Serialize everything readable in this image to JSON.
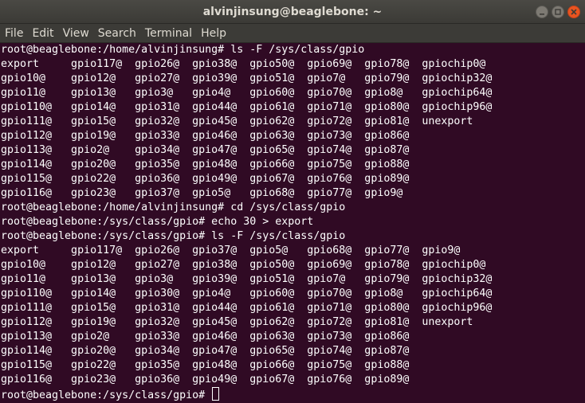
{
  "window": {
    "title": "alvinjinsung@beaglebone: ~",
    "colors": {
      "terminal_bg": "#300a24",
      "terminal_fg": "#ffffff",
      "titlebar": "#3c3b37",
      "close_button": "#e95420"
    }
  },
  "menu": {
    "file": "File",
    "edit": "Edit",
    "view": "View",
    "search": "Search",
    "terminal": "Terminal",
    "help": "Help"
  },
  "terminal": {
    "lines": [
      "root@beaglebone:/home/alvinjinsung# ls -F /sys/class/gpio",
      "export     gpio117@  gpio26@  gpio38@  gpio50@  gpio69@  gpio78@  gpiochip0@",
      "gpio10@    gpio12@   gpio27@  gpio39@  gpio51@  gpio7@   gpio79@  gpiochip32@",
      "gpio11@    gpio13@   gpio3@   gpio4@   gpio60@  gpio70@  gpio8@   gpiochip64@",
      "gpio110@   gpio14@   gpio31@  gpio44@  gpio61@  gpio71@  gpio80@  gpiochip96@",
      "gpio111@   gpio15@   gpio32@  gpio45@  gpio62@  gpio72@  gpio81@  unexport",
      "gpio112@   gpio19@   gpio33@  gpio46@  gpio63@  gpio73@  gpio86@",
      "gpio113@   gpio2@    gpio34@  gpio47@  gpio65@  gpio74@  gpio87@",
      "gpio114@   gpio20@   gpio35@  gpio48@  gpio66@  gpio75@  gpio88@",
      "gpio115@   gpio22@   gpio36@  gpio49@  gpio67@  gpio76@  gpio89@",
      "gpio116@   gpio23@   gpio37@  gpio5@   gpio68@  gpio77@  gpio9@",
      "root@beaglebone:/home/alvinjinsung# cd /sys/class/gpio",
      "root@beaglebone:/sys/class/gpio# echo 30 > export",
      "root@beaglebone:/sys/class/gpio# ls -F /sys/class/gpio",
      "export     gpio117@  gpio26@  gpio37@  gpio5@   gpio68@  gpio77@  gpio9@",
      "gpio10@    gpio12@   gpio27@  gpio38@  gpio50@  gpio69@  gpio78@  gpiochip0@",
      "gpio11@    gpio13@   gpio3@   gpio39@  gpio51@  gpio7@   gpio79@  gpiochip32@",
      "gpio110@   gpio14@   gpio30@  gpio4@   gpio60@  gpio70@  gpio8@   gpiochip64@",
      "gpio111@   gpio15@   gpio31@  gpio44@  gpio61@  gpio71@  gpio80@  gpiochip96@",
      "gpio112@   gpio19@   gpio32@  gpio45@  gpio62@  gpio72@  gpio81@  unexport",
      "gpio113@   gpio2@    gpio33@  gpio46@  gpio63@  gpio73@  gpio86@",
      "gpio114@   gpio20@   gpio34@  gpio47@  gpio65@  gpio74@  gpio87@",
      "gpio115@   gpio22@   gpio35@  gpio48@  gpio66@  gpio75@  gpio88@",
      "gpio116@   gpio23@   gpio36@  gpio49@  gpio67@  gpio76@  gpio89@"
    ],
    "prompt": "root@beaglebone:/sys/class/gpio# "
  }
}
